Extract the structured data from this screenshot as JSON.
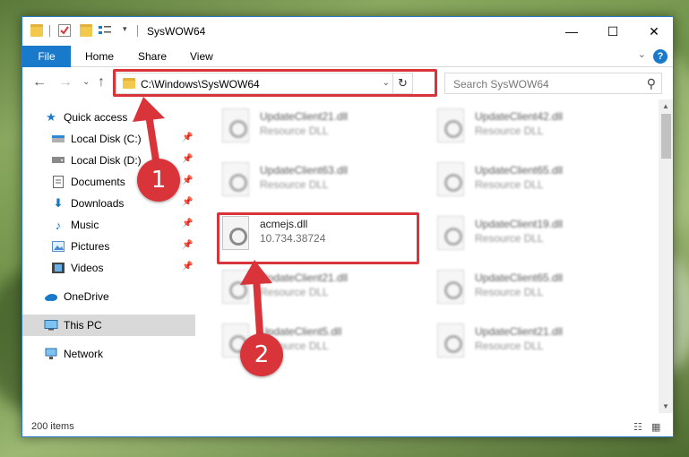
{
  "window": {
    "title": "SysWOW64",
    "minimize": "—",
    "maximize": "☐",
    "close": "✕"
  },
  "ribbon": {
    "file": "File",
    "tabs": [
      "Home",
      "Share",
      "View"
    ],
    "help": "?"
  },
  "nav": {
    "address": "C:\\Windows\\SysWOW64",
    "search_placeholder": "Search SysWOW64"
  },
  "sidebar": {
    "items": [
      {
        "label": "Quick access",
        "icon": "star-icon"
      },
      {
        "label": "Local Disk (C:)",
        "icon": "drive-icon"
      },
      {
        "label": "Local Disk (D:)",
        "icon": "drive-icon"
      },
      {
        "label": "Documents",
        "icon": "documents-icon"
      },
      {
        "label": "Downloads",
        "icon": "download-icon"
      },
      {
        "label": "Music",
        "icon": "music-icon"
      },
      {
        "label": "Pictures",
        "icon": "pictures-icon"
      },
      {
        "label": "Videos",
        "icon": "videos-icon"
      },
      {
        "label": "OneDrive",
        "icon": "cloud-icon"
      },
      {
        "label": "This PC",
        "icon": "computer-icon"
      },
      {
        "label": "Network",
        "icon": "network-icon"
      }
    ]
  },
  "files": [
    {
      "name": "UpdateClient21.dll",
      "desc": "Resource DLL"
    },
    {
      "name": "UpdateClient42.dll",
      "desc": "Resource DLL"
    },
    {
      "name": "UpdateClient63.dll",
      "desc": "Resource DLL"
    },
    {
      "name": "UpdateClient65.dll",
      "desc": "Resource DLL"
    },
    {
      "name": "acmejs.dll",
      "desc": "10.734.38724"
    },
    {
      "name": "UpdateClient19.dll",
      "desc": "Resource DLL"
    },
    {
      "name": "UpdateClient21.dll",
      "desc": "Resource DLL"
    },
    {
      "name": "UpdateClient65.dll",
      "desc": "Resource DLL"
    },
    {
      "name": "UpdateClient5.dll",
      "desc": "Resource DLL"
    },
    {
      "name": "UpdateClient21.dll",
      "desc": "Resource DLL"
    }
  ],
  "status": {
    "count": "200 items"
  },
  "annotations": {
    "badge1": "1",
    "badge2": "2",
    "color": "#d9343a"
  }
}
